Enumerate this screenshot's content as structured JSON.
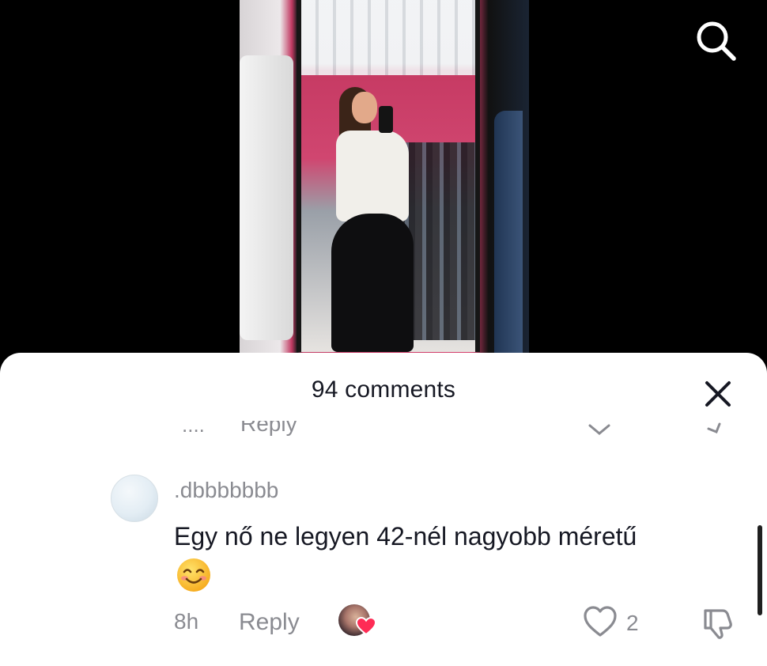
{
  "video": {
    "description_hidden": ""
  },
  "icons": {
    "search": "search-icon",
    "close": "close-icon",
    "like": "heart-outline-icon",
    "dislike": "thumbs-down-icon",
    "emoji": "smiling-face-emoji"
  },
  "comments_sheet": {
    "title": "94 comments",
    "previous_comment": {
      "time_fragment": "....",
      "reply_label": "Reply"
    },
    "comment": {
      "username": ".dbbbbbbb",
      "text": "Egy nő ne legyen 42-nél nagyobb méretű",
      "time": "8h",
      "reply_label": "Reply",
      "like_count": "2"
    }
  },
  "colors": {
    "primary_text": "#161823",
    "secondary_text": "#8a8b91",
    "heart_badge": "#fe2c55",
    "sheet_background": "#ffffff"
  }
}
